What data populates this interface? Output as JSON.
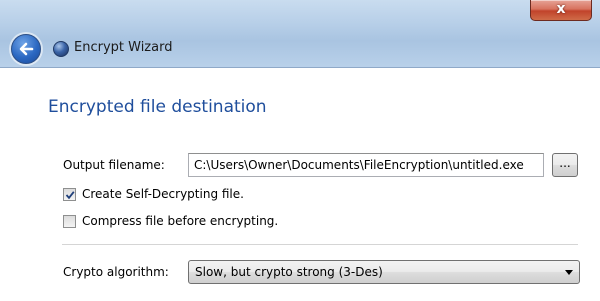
{
  "window": {
    "title": "Encrypt Wizard",
    "close_glyph": "x"
  },
  "icons": {
    "back": "back-arrow-icon",
    "app": "app-globe-icon",
    "close": "close-icon",
    "check": "checkmark-icon",
    "dropdown": "chevron-down-icon"
  },
  "page": {
    "heading": "Encrypted file destination"
  },
  "output": {
    "label": "Output filename:",
    "value": "C:\\Users\\Owner\\Documents\\FileEncryption\\untitled.exe",
    "browse_label": "..."
  },
  "options": {
    "self_decrypting": {
      "label": "Create Self-Decrypting file.",
      "checked": true
    },
    "compress": {
      "label": "Compress file before encrypting.",
      "checked": false
    }
  },
  "crypto": {
    "label": "Crypto algorithm:",
    "selected": "Slow, but crypto strong (3-Des)"
  },
  "colors": {
    "heading": "#1f4e9c",
    "titlebar": "#b7cfe8",
    "close": "#c1432b"
  }
}
